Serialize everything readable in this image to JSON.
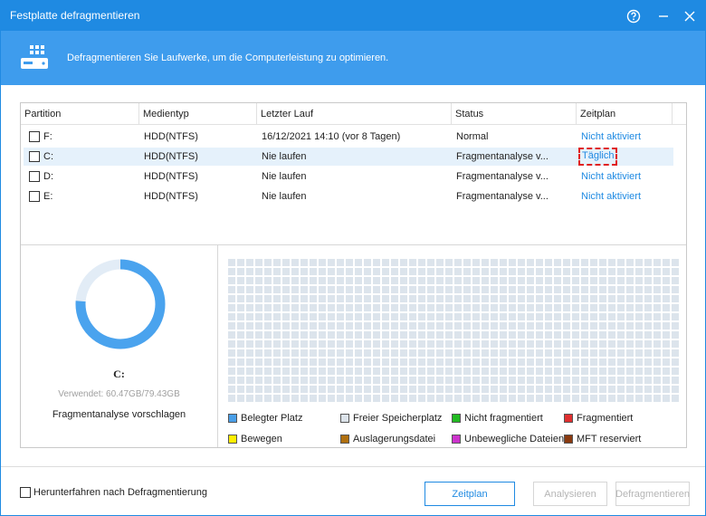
{
  "window": {
    "title": "Festplatte defragmentieren"
  },
  "banner": {
    "description": "Defragmentieren Sie Laufwerke, um die Computerleistung zu optimieren."
  },
  "table": {
    "columns": [
      "Partition",
      "Medientyp",
      "Letzter Lauf",
      "Status",
      "Zeitplan"
    ],
    "rows": [
      {
        "partition": "F:",
        "media": "HDD(NTFS)",
        "last_run": "16/12/2021 14:10 (vor 8 Tagen)",
        "status": "Normal",
        "schedule": "Nicht aktiviert",
        "selected": false
      },
      {
        "partition": "C:",
        "media": "HDD(NTFS)",
        "last_run": "Nie laufen",
        "status": "Fragmentanalyse v...",
        "schedule": "Täglich",
        "selected": true
      },
      {
        "partition": "D:",
        "media": "HDD(NTFS)",
        "last_run": "Nie laufen",
        "status": "Fragmentanalyse v...",
        "schedule": "Nicht aktiviert",
        "selected": false
      },
      {
        "partition": "E:",
        "media": "HDD(NTFS)",
        "last_run": "Nie laufen",
        "status": "Fragmentanalyse v...",
        "schedule": "Nicht aktiviert",
        "selected": false
      }
    ]
  },
  "summary": {
    "drive": "C:",
    "used": "Verwendet: 60.47GB/79.43GB",
    "used_fraction": 0.761,
    "suggestion": "Fragmentanalyse vorschlagen"
  },
  "legend": [
    {
      "label": "Belegter Platz",
      "color": "#4a9fe8"
    },
    {
      "label": "Freier Speicherplatz",
      "color": "#dce3ea"
    },
    {
      "label": "Nicht fragmentiert",
      "color": "#22bb22"
    },
    {
      "label": "Fragmentiert",
      "color": "#e03030"
    },
    {
      "label": "Bewegen",
      "color": "#ffee00"
    },
    {
      "label": "Auslagerungsdatei",
      "color": "#b07010"
    },
    {
      "label": "Unbewegliche Dateien",
      "color": "#cc33cc"
    },
    {
      "label": "MFT reserviert",
      "color": "#8a3a10"
    }
  ],
  "footer": {
    "shutdown_label": "Herunterfahren nach Defragmentierung",
    "schedule_button": "Zeitplan",
    "analyze_button": "Analysieren",
    "defrag_button": "Defragmentieren"
  },
  "colors": {
    "accent": "#1f8ae2",
    "banner": "#3e9ced",
    "donut_fill": "#4aa3ee",
    "donut_track": "#e2ecf6",
    "block_free": "#dce4ec"
  }
}
